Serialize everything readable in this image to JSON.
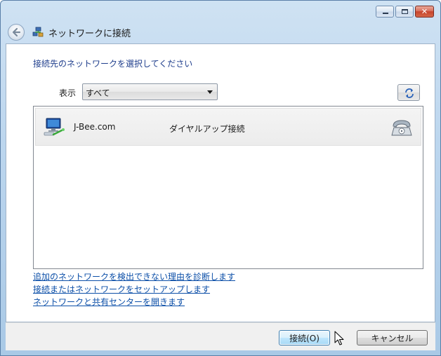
{
  "window": {
    "title": "ネットワークに接続",
    "caption_buttons": {
      "minimize_icon": "minimize-icon",
      "maximize_icon": "maximize-icon",
      "close_glyph": "✕"
    }
  },
  "content": {
    "instruction": "接続先のネットワークを選択してください",
    "show_label": "表示",
    "filter_selected": "すべて",
    "networks": [
      {
        "name": "J-Bee.com",
        "type": "ダイヤルアップ接続",
        "icon": "network-computer-icon",
        "status_icon": "telephone-icon"
      }
    ],
    "links": [
      "追加のネットワークを検出できない理由を診断します",
      "接続またはネットワークをセットアップします",
      "ネットワークと共有センターを開きます"
    ]
  },
  "footer": {
    "connect_label": "接続(O)",
    "cancel_label": "キャンセル"
  },
  "colors": {
    "frame": "#bcd6ee",
    "link": "#0c4fa8",
    "instruction": "#1f3e8c"
  }
}
